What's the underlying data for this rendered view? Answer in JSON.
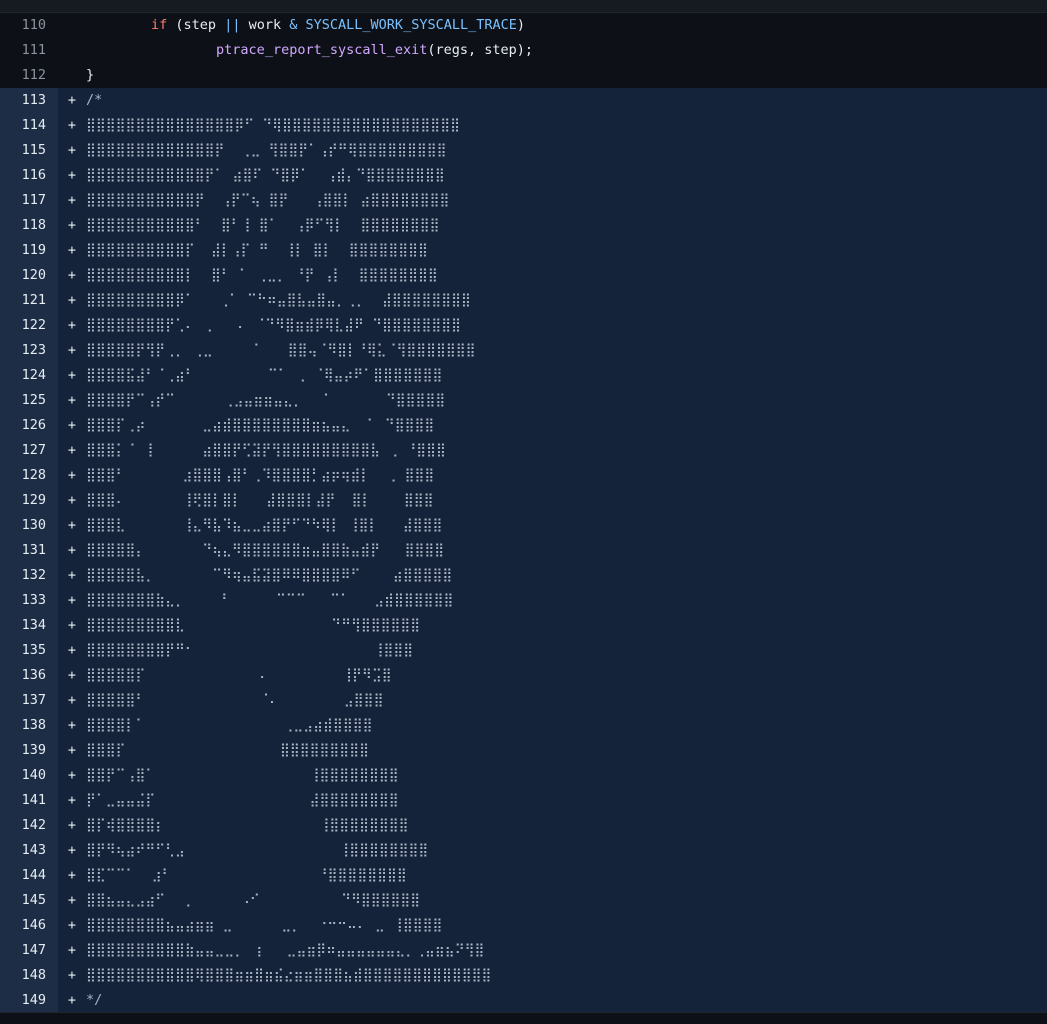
{
  "context_lines": [
    {
      "num": "110",
      "indent": "        ",
      "kw": "if",
      "p1": " (step ",
      "op1": "||",
      "p2": " work ",
      "op2": "&",
      "p3": " ",
      "const": "SYSCALL_WORK_SYSCALL_TRACE",
      "p4": ")"
    },
    {
      "num": "111",
      "indent": "                ",
      "fn": "ptrace_report_syscall_exit",
      "rest": "(regs, step);"
    },
    {
      "num": "112",
      "text": "}"
    }
  ],
  "added_marker": "+",
  "added_lines": [
    {
      "num": "113",
      "text": "/*"
    },
    {
      "num": "114",
      "text": "⣿⣿⣿⣿⣿⣿⣿⣿⣿⣿⣿⣿⣿⣿⣿⡿⠋ ⠙⢿⣿⣿⣿⣿⣿⣿⣿⣿⣿⣿⣿⣿⣿⣿⣿⣿⣿⣿"
    },
    {
      "num": "115",
      "text": "⣿⣿⣿⣿⣿⣿⣿⣿⣿⣿⣿⣿⣿⡟  ⢀⣀ ⢻⣿⣿⡟⠁⢠⡞⠛⢿⣿⣿⣿⣿⣿⣿⣿⣿⣿"
    },
    {
      "num": "116",
      "text": "⣿⣿⣿⣿⣿⣿⣿⣿⣿⣿⣿⣿⡟⠁ ⣴⣿⠏ ⠙⣿⡿⠁  ⢠⣾⡄⠙⣿⣿⣿⣿⣿⣿⣿⣿"
    },
    {
      "num": "117",
      "text": "⣿⣿⣿⣿⣿⣿⣿⣿⣿⣿⣿⡟  ⢠⡟⠉⢦ ⣿⡟   ⢠⣿⣿⡇ ⣴⣿⣿⣿⣿⣿⣿⣿⣿"
    },
    {
      "num": "118",
      "text": "⣿⣿⣿⣿⣿⣿⣿⣿⣿⣿⣿⠃  ⣿⠃⢸ ⣿⠁  ⢠⡿⠋⢻⡇  ⣿⣿⣿⣿⣿⣿⣿⣿"
    },
    {
      "num": "119",
      "text": "⣿⣿⣿⣿⣿⣿⣿⣿⣿⣿⡏  ⣼⡇⢠⡏ ⠛  ⢸⡇ ⣿⡇  ⣿⣿⣿⣿⣿⣿⣿⣿"
    },
    {
      "num": "120",
      "text": "⣿⣿⣿⣿⣿⣿⣿⣿⣿⣿⡇  ⣿⠃ ⠁ ⢀⣀⡀ ⠘⡟ ⢠⡇  ⣿⣿⣿⣿⣿⣿⣿⣿"
    },
    {
      "num": "121",
      "text": "⣿⣿⣿⣿⣿⣿⣿⣿⣿⡿⠁   ⢀⠁ ⠉⠓⠶⣤⣿⣧⣤⣿⣤⡀⢀⡀  ⣼⣿⣿⣿⣿⣿⣿⣿⣿"
    },
    {
      "num": "122",
      "text": "⣿⣿⣿⣿⣿⣿⣿⣿⡟⢁⠄ ⢀   ⠄ ⠈⠙⠻⣿⣶⣾⡿⢿⣇⣼⠟ ⠙⣿⣿⣿⣿⣿⣿⣿⣿"
    },
    {
      "num": "123",
      "text": "⣿⣿⣿⣿⣿⡟⢻⡟⢀⡀ ⢀⣀     ⠁   ⣿⣿⢤⠈⠻⣿⡇⠘⢿⣅⠈⢻⣿⣿⣿⣿⣿⣿⣿"
    },
    {
      "num": "124",
      "text": "⣿⣿⣿⣿⣯⣼⠃⠈⢀⣴⠃         ⠉⠁ ⢀ ⠈⢿⣤⡴⠟⠁⣿⣿⣿⣿⣿⣿⣿"
    },
    {
      "num": "125",
      "text": "⣿⣿⣿⣿⡟⠉⢠⡞⠉      ⢀⣠⣤⣶⣶⣤⣄⡀  ⠈       ⠙⣿⣿⣿⣿⣿"
    },
    {
      "num": "126",
      "text": "⣿⣿⣿⡏⢀⡴       ⣀⣴⣾⣿⣿⣿⣿⣿⣿⣿⣿⣶⣦⣤⣄  ⠁ ⠙⣿⣿⣿⣿"
    },
    {
      "num": "127",
      "text": "⣿⣿⣿⡅⠈ ⢸      ⣴⣿⣿⡟⢋⣽⡟⢻⣿⣿⣿⣿⣿⣿⣿⣿⣿⣧ ⢀ ⠘⣿⣿⣿"
    },
    {
      "num": "128",
      "text": "⣿⣿⣿⠃       ⣰⣿⣿⣿⢠⣿⠃⢀⠹⣿⣿⣿⣿⡃⣴⡶⢶⣾⡇  ⢀ ⣿⣿⣿"
    },
    {
      "num": "129",
      "text": "⣿⣿⣿⠄       ⢸⢟⣿⡇⣿⡇   ⣼⣿⣿⣿⡇⣼⡟  ⣿⡇    ⣿⣿⣿"
    },
    {
      "num": "130",
      "text": "⣿⣿⣿⣇       ⢸⣄⠻⣧⠹⣦⣀⣀⣴⣿⡟⠋⠙⠳⢿⡇ ⢸⣿⡇   ⣼⣿⣿⣿"
    },
    {
      "num": "131",
      "text": "⣿⣿⣿⣿⣿⡄       ⠙⢦⣄⠻⣿⣿⣿⣿⣿⣿⣶⣤⣿⣿⣷⣤⣾⡟   ⣿⣿⣿⣿"
    },
    {
      "num": "132",
      "text": "⣿⣿⣿⣿⣿⣧⡀       ⠉⠻⢶⣤⣯⣽⣿⠿⠿⣿⣿⣿⣿⠿⠋    ⣴⣿⣿⣿⣿⣿"
    },
    {
      "num": "133",
      "text": "⣿⣿⣿⣿⣿⣿⣿⣷⣄⡀    ⠘      ⠉⠉⠉   ⠉⠁   ⣠⣾⣿⣿⣿⣿⣿⣿"
    },
    {
      "num": "134",
      "text": "⣿⣿⣿⣿⣿⣿⣿⣿⣿⣇                  ⠙⠛⢻⣿⣿⣿⣿⣿⣿"
    },
    {
      "num": "135",
      "text": "⣿⣿⣿⣿⣿⣿⣿⣿⡟⠛⠂                      ⢸⣿⣿⣿"
    },
    {
      "num": "136",
      "text": "⣿⣿⣿⣿⣿⡏              ⠄         ⢸⡟⠻⣩⣿"
    },
    {
      "num": "137",
      "text": "⣿⣿⣿⣿⣿⠃              ⠈⠄        ⣠⣿⣿⣿"
    },
    {
      "num": "138",
      "text": "⣿⣿⣿⣿⡇⠁                 ⢀⣀⣠⣴⣾⣿⣿⣿⣿"
    },
    {
      "num": "139",
      "text": "⣿⣿⣿⡏                   ⣿⣿⣿⣿⣿⣿⣿⣿⣿"
    },
    {
      "num": "140",
      "text": "⣿⣿⡟⠉⢠⣿⠁                   ⢸⣿⣿⣿⣿⣿⣿⣿⣿"
    },
    {
      "num": "141",
      "text": "⡟⠁⣀⣤⣤⣬⡏                   ⣼⣿⣿⣿⣿⣿⣿⣿⣿"
    },
    {
      "num": "142",
      "text": "⣿⡏⢾⣿⣿⣿⣿⡆                   ⢸⣿⣿⣿⣿⣿⣿⣿⣿"
    },
    {
      "num": "143",
      "text": "⣿⡟⠻⢦⣴⠞⠛⠋⢃⣠                   ⢸⣿⣿⣿⣿⣿⣿⣿⣿"
    },
    {
      "num": "144",
      "text": "⣿⣏⠉⠉⠁  ⣰⠃                  ⠘⣿⣿⣿⣿⣿⣿⣿⣿"
    },
    {
      "num": "145",
      "text": "⣿⣿⣦⣤⣄⣠⣴⠋  ⢀      ⠠⠊          ⠙⠻⣿⣿⣿⣿⣿⣿"
    },
    {
      "num": "146",
      "text": "⣿⣿⣿⣿⣿⣿⣿⣿⣦⣤⣴⣶⣶ ⣀      ⣀⡀  ⠐⠒⠒⠤⠄ ⣀ ⢸⣿⣿⣿⣿"
    },
    {
      "num": "147",
      "text": "⣿⣿⣿⣿⣿⣿⣿⣿⣿⣿⣷⣤⣤⣀⣀⡀ ⢰   ⣀⣤⣶⡿⠶⣤⣤⣤⣤⣤⣤⣄⡀⢀⣤⣶⣦⠝⢻⣿"
    },
    {
      "num": "148",
      "text": "⣿⣿⣿⣿⣿⣿⣿⣿⣿⣿⣿⢿⣿⣿⣿⣶⣶⣿⣶⣮⣔⣶⣶⣿⣿⣿⣦⣾⣿⣿⣿⣿⣿⣿⣿⣿⣿⣿⣿⣿⣿"
    },
    {
      "num": "149",
      "text": "*/"
    }
  ]
}
